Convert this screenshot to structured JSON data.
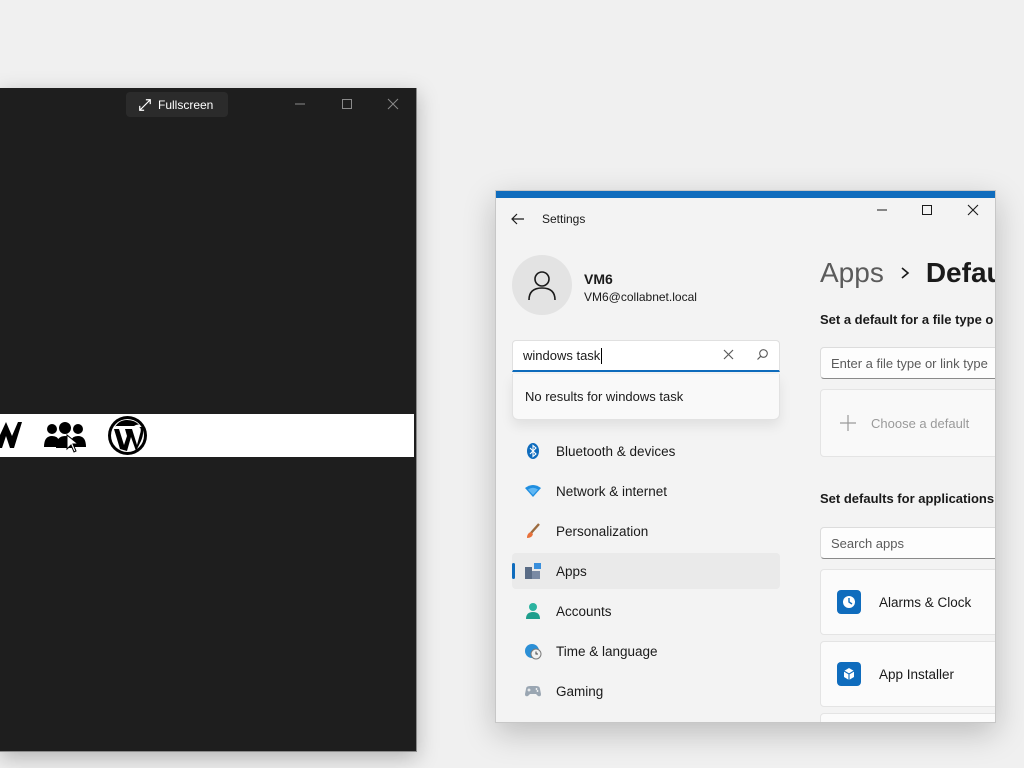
{
  "remote_window": {
    "fullscreen_label": "Fullscreen"
  },
  "settings": {
    "title": "Settings",
    "user": {
      "name": "VM6",
      "email": "VM6@collabnet.local"
    },
    "search": {
      "value": "windows task",
      "no_results": "No results for windows task"
    },
    "nav": [
      {
        "label": "Bluetooth & devices",
        "icon": "bluetooth-icon"
      },
      {
        "label": "Network & internet",
        "icon": "wifi-icon"
      },
      {
        "label": "Personalization",
        "icon": "brush-icon"
      },
      {
        "label": "Apps",
        "icon": "apps-icon",
        "active": true
      },
      {
        "label": "Accounts",
        "icon": "accounts-icon"
      },
      {
        "label": "Time & language",
        "icon": "globe-clock-icon"
      },
      {
        "label": "Gaming",
        "icon": "gamepad-icon"
      }
    ],
    "breadcrumb": {
      "parent": "Apps",
      "current": "Defau"
    },
    "file_type_section": {
      "title": "Set a default for a file type o",
      "placeholder": "Enter a file type or link type",
      "choose_label": "Choose a default"
    },
    "apps_section": {
      "title": "Set defaults for applications",
      "search_placeholder": "Search apps",
      "apps": [
        {
          "name": "Alarms & Clock"
        },
        {
          "name": "App Installer"
        }
      ]
    },
    "accent_color": "#0f6cbd"
  }
}
